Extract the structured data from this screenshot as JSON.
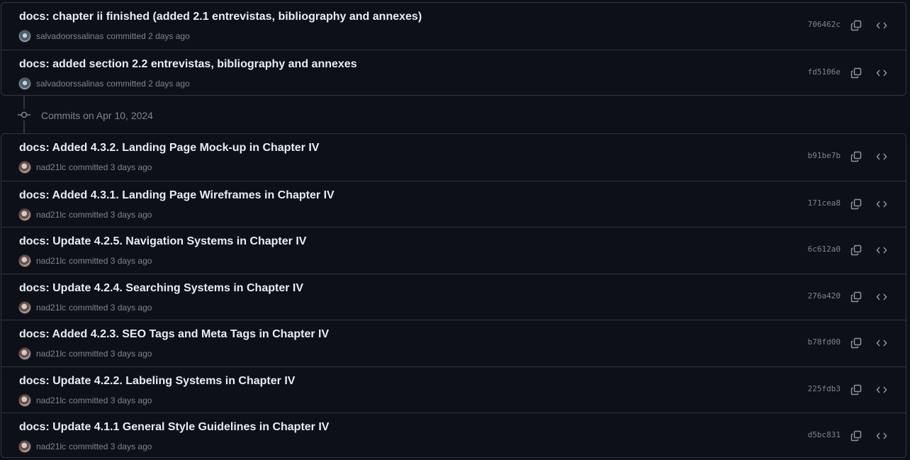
{
  "groups": [
    {
      "commits": [
        {
          "message": "docs: chapter ii finished (added 2.1 entrevistas, bibliography and annexes)",
          "author": "salvadoorssalinas",
          "time": "committed 2 days ago",
          "sha": "706462c"
        },
        {
          "message": "docs: added section 2.2 entrevistas, bibliography and annexes",
          "author": "salvadoorssalinas",
          "time": "committed 2 days ago",
          "sha": "fd5106e"
        }
      ]
    },
    {
      "date_header": "Commits on Apr 10, 2024",
      "commits": [
        {
          "message": "docs: Added 4.3.2. Landing Page Mock-up in Chapter IV",
          "author": "nad21lc",
          "time": "committed 3 days ago",
          "sha": "b91be7b"
        },
        {
          "message": "docs: Added 4.3.1. Landing Page Wireframes in Chapter IV",
          "author": "nad21lc",
          "time": "committed 3 days ago",
          "sha": "171cea8"
        },
        {
          "message": "docs: Update 4.2.5. Navigation Systems in Chapter IV",
          "author": "nad21lc",
          "time": "committed 3 days ago",
          "sha": "6c612a0"
        },
        {
          "message": "docs: Update 4.2.4. Searching Systems in Chapter IV",
          "author": "nad21lc",
          "time": "committed 3 days ago",
          "sha": "276a420"
        },
        {
          "message": "docs: Added 4.2.3. SEO Tags and Meta Tags in Chapter IV",
          "author": "nad21lc",
          "time": "committed 3 days ago",
          "sha": "b78fd00"
        },
        {
          "message": "docs: Update 4.2.2. Labeling Systems in Chapter IV",
          "author": "nad21lc",
          "time": "committed 3 days ago",
          "sha": "225fdb3"
        },
        {
          "message": "docs: Update 4.1.1 General Style Guidelines in Chapter IV",
          "author": "nad21lc",
          "time": "committed 3 days ago",
          "sha": "d5bc831"
        }
      ]
    }
  ],
  "icons": {
    "copy": "copy-icon",
    "browse": "code-icon",
    "node": "git-commit-icon"
  },
  "colors": {
    "background": "#0d1117",
    "border": "#30363d",
    "text": "#e6edf3",
    "muted": "#7d8590"
  }
}
